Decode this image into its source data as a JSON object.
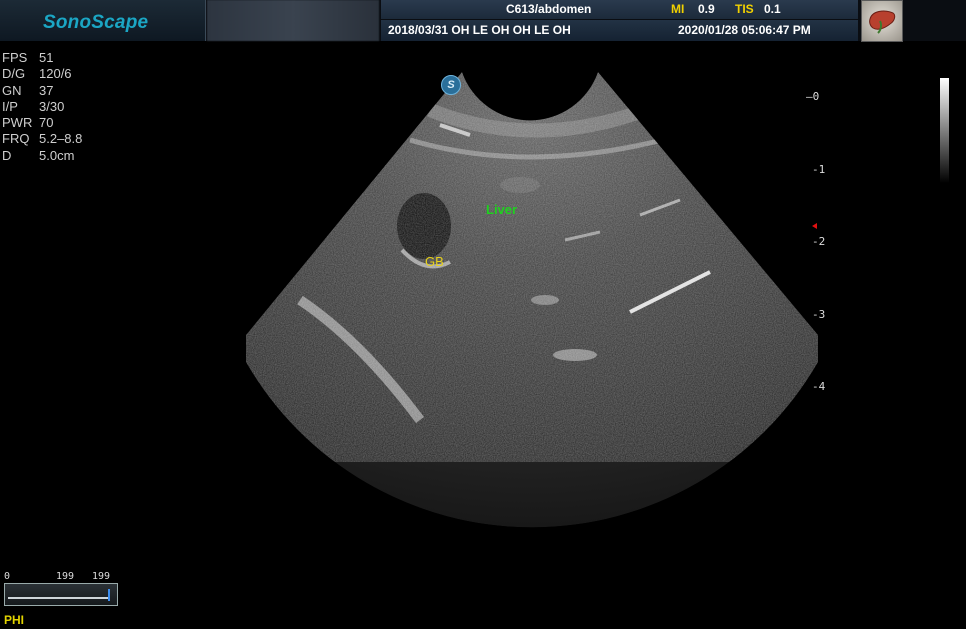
{
  "header": {
    "brand": "SonoScape",
    "probe_preset": "C613/abdomen",
    "mi_label": "MI",
    "mi_value": "0.9",
    "tis_label": "TIS",
    "tis_value": "0.1",
    "patient_line": "2018/03/31  OH LE OH OH LE OH",
    "datetime": "2020/01/28 05:06:47 PM"
  },
  "params": [
    {
      "key": "FPS",
      "value": "51"
    },
    {
      "key": "D/G",
      "value": "120/6"
    },
    {
      "key": "GN",
      "value": "37"
    },
    {
      "key": "I/P",
      "value": "3/30"
    },
    {
      "key": "PWR",
      "value": "70"
    },
    {
      "key": "FRQ",
      "value": "5.2–8.8"
    },
    {
      "key": "D",
      "value": "5.0cm"
    }
  ],
  "annotations": {
    "liver": "Liver",
    "gb": "GB",
    "probe_marker": "S"
  },
  "depth_scale": [
    "0",
    "-1",
    "-2",
    "-3",
    "-4"
  ],
  "cine": {
    "start": "0",
    "current": "199",
    "total": "199"
  },
  "mode_label": "PHI",
  "colors": {
    "brand": "#1ba6c4",
    "yellow_label": "#f1d100",
    "liver_label": "#1fd11f",
    "gb_label": "#e8d21a",
    "focus_marker": "#e01010"
  }
}
